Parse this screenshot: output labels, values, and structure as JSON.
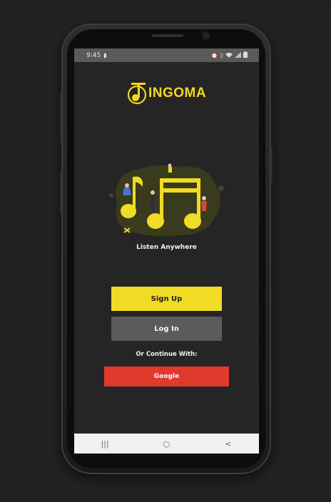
{
  "status_bar": {
    "time": "9:45",
    "icons": [
      "camera-icon",
      "alarm-icon",
      "vibrate-icon",
      "wifi-icon",
      "signal-icon",
      "battery-icon"
    ]
  },
  "app": {
    "logo_text": "INGOMA",
    "tagline": "Listen Anywhere"
  },
  "actions": {
    "signup_label": "Sign Up",
    "login_label": "Log In",
    "or_text": "Or Continue With:",
    "google_label": "Google"
  },
  "nav": {
    "recents": "|||",
    "home": "○",
    "back": "<"
  },
  "colors": {
    "accent": "#f1dc25",
    "login_button": "#5b5b5b",
    "google_button": "#e0392e",
    "screen_background": "#252525"
  }
}
